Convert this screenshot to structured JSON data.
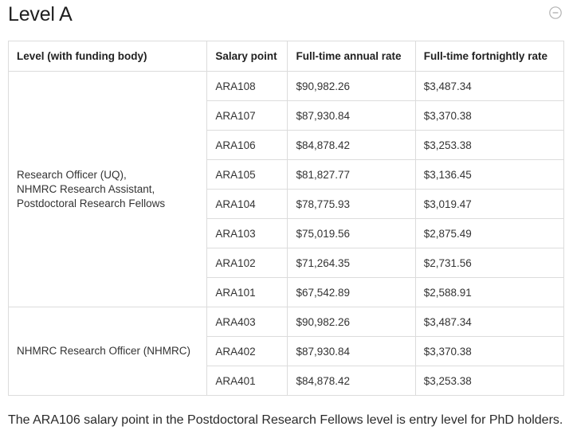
{
  "section": {
    "title": "Level A",
    "toggle_icon": "minus-circle-icon"
  },
  "table": {
    "headers": {
      "level": "Level (with funding body)",
      "salary_point": "Salary point",
      "annual": "Full-time annual rate",
      "fortnightly": "Full-time fortnightly rate"
    },
    "groups": [
      {
        "level_lines": [
          "Research Officer (UQ),",
          "NHMRC Research Assistant,",
          "Postdoctoral Research Fellows"
        ],
        "rows": [
          {
            "point": "ARA108",
            "annual": "$90,982.26",
            "fortnightly": "$3,487.34"
          },
          {
            "point": "ARA107",
            "annual": "$87,930.84",
            "fortnightly": "$3,370.38"
          },
          {
            "point": "ARA106",
            "annual": "$84,878.42",
            "fortnightly": "$3,253.38"
          },
          {
            "point": "ARA105",
            "annual": "$81,827.77",
            "fortnightly": "$3,136.45"
          },
          {
            "point": "ARA104",
            "annual": "$78,775.93",
            "fortnightly": "$3,019.47"
          },
          {
            "point": "ARA103",
            "annual": "$75,019.56",
            "fortnightly": "$2,875.49"
          },
          {
            "point": "ARA102",
            "annual": "$71,264.35",
            "fortnightly": "$2,731.56"
          },
          {
            "point": "ARA101",
            "annual": "$67,542.89",
            "fortnightly": "$2,588.91"
          }
        ]
      },
      {
        "level_lines": [
          "NHMRC Research Officer (NHMRC)"
        ],
        "rows": [
          {
            "point": "ARA403",
            "annual": "$90,982.26",
            "fortnightly": "$3,487.34"
          },
          {
            "point": "ARA402",
            "annual": "$87,930.84",
            "fortnightly": "$3,370.38"
          },
          {
            "point": "ARA401",
            "annual": "$84,878.42",
            "fortnightly": "$3,253.38"
          }
        ]
      }
    ]
  },
  "footnote": "The ARA106 salary point in the Postdoctoral Research Fellows level is entry level for PhD holders."
}
